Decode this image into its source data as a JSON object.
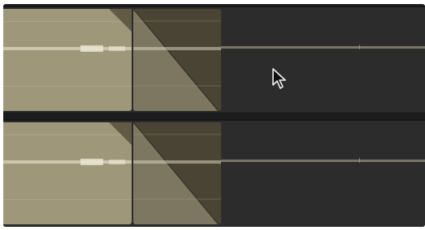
{
  "timeline": {
    "tracks": [
      {
        "clip": "audio-clip",
        "crossfade": "fade-out"
      },
      {
        "clip": "audio-clip",
        "crossfade": "fade-out"
      }
    ],
    "colors": {
      "clip": "#9f977a",
      "clip_selected": "#615a44",
      "track_background": "#2d2c2d",
      "waveform": "#d8d2bd"
    },
    "pointer_icon": "mouse-arrow-icon"
  }
}
